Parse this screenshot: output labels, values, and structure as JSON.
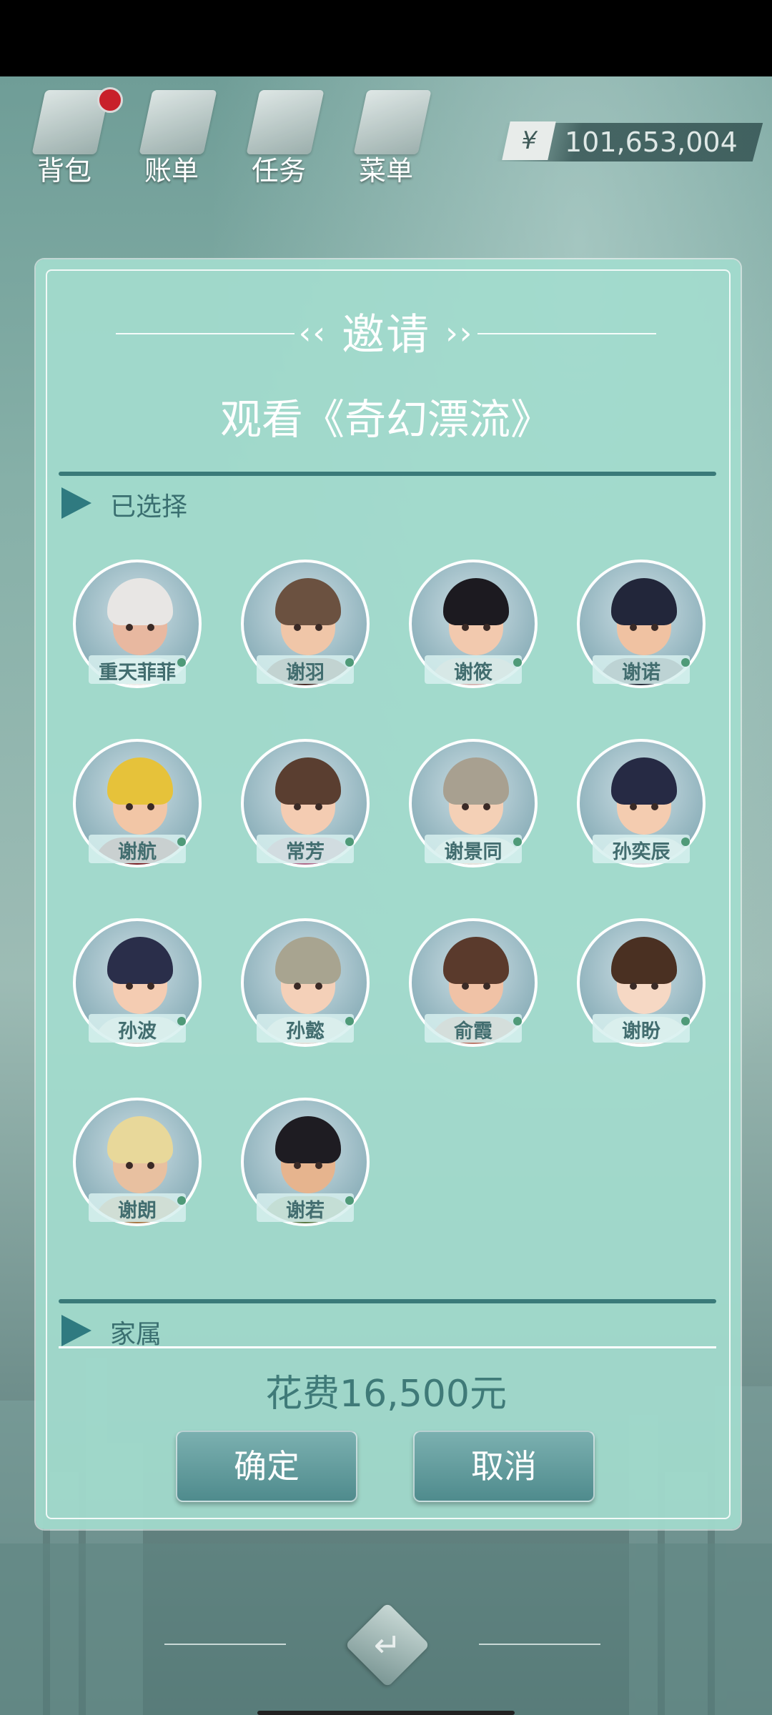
{
  "hud": {
    "items": [
      {
        "label": "背包",
        "icon": "bag-icon"
      },
      {
        "label": "账单",
        "icon": "bill-icon"
      },
      {
        "label": "任务",
        "icon": "task-icon"
      },
      {
        "label": "菜单",
        "icon": "menu-icon"
      }
    ],
    "currency_symbol": "¥",
    "money": "101,653,004"
  },
  "dialog": {
    "title": "邀请",
    "subtitle": "观看《奇幻漂流》",
    "selected_label": "已选择",
    "family_label": "家属",
    "cost": "花费16,500元",
    "confirm": "确定",
    "cancel": "取消",
    "characters": [
      {
        "name": "重天菲菲",
        "hair": "#e8e6e4",
        "body": "#f1efea",
        "skin": "#e8b8a0"
      },
      {
        "name": "谢羽",
        "hair": "#6b5140",
        "body": "#4a2e28",
        "skin": "#f0c6a8"
      },
      {
        "name": "谢筱",
        "hair": "#1c1a20",
        "body": "#d8b8b4",
        "skin": "#f2c9ae"
      },
      {
        "name": "谢诺",
        "hair": "#22263a",
        "body": "#2c3440",
        "skin": "#f0c2a2"
      },
      {
        "name": "谢航",
        "hair": "#e6c23a",
        "body": "#7a1e22",
        "skin": "#f2c6a6"
      },
      {
        "name": "常芳",
        "hair": "#5a3e30",
        "body": "#b06a8a",
        "skin": "#f4ccb2"
      },
      {
        "name": "谢景同",
        "hair": "#a8a090",
        "body": "#e8e4dc",
        "skin": "#f4d0b6"
      },
      {
        "name": "孙奕辰",
        "hair": "#262a44",
        "body": "#e0e0e4",
        "skin": "#f4ccb0"
      },
      {
        "name": "孙波",
        "hair": "#2a2e4a",
        "body": "#e4e0dc",
        "skin": "#f4ccb2"
      },
      {
        "name": "孙懿",
        "hair": "#a8a490",
        "body": "#e6e2da",
        "skin": "#f4d0b8"
      },
      {
        "name": "俞霞",
        "hair": "#5a3a2c",
        "body": "#c07a6a",
        "skin": "#f0c2a6"
      },
      {
        "name": "谢盼",
        "hair": "#4a3022",
        "body": "#ece8e4",
        "skin": "#f6d8c4"
      },
      {
        "name": "谢朗",
        "hair": "#e8d89a",
        "body": "#a87842",
        "skin": "#e8c0a0"
      },
      {
        "name": "谢若",
        "hair": "#1e1c22",
        "body": "#5a7a44",
        "skin": "#e6b48e"
      }
    ]
  }
}
